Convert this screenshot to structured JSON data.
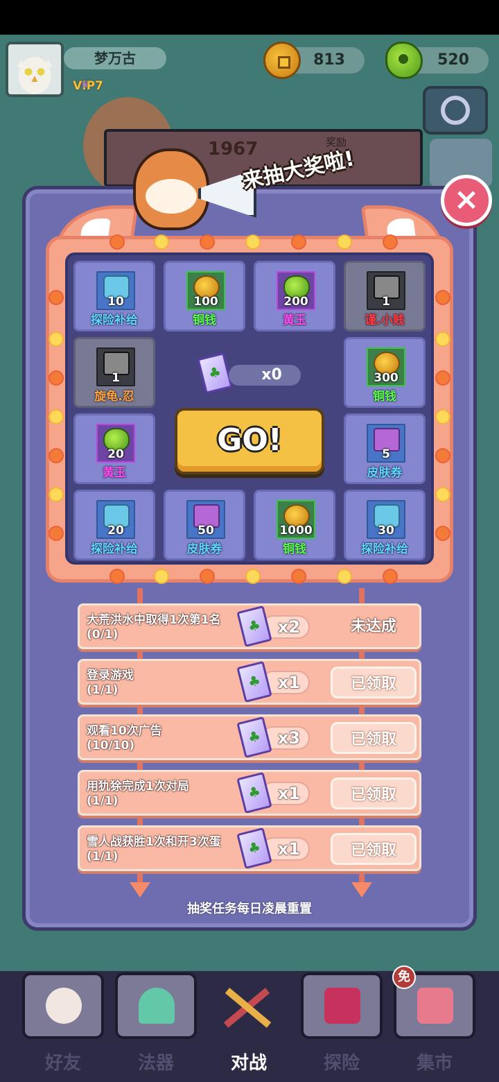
{
  "player": {
    "name": "梦万古",
    "vip": "VIP7"
  },
  "currency": {
    "copper": "813",
    "jade": "520"
  },
  "rank": {
    "score": "1967",
    "reward_label": "奖励"
  },
  "banner": {
    "text": "来抽大奖啦!"
  },
  "close_label": "×",
  "draw": {
    "ticket_count": "x0",
    "go_label": "GO!",
    "cells": [
      {
        "amount": "10",
        "label": "探险补给",
        "type": "supply",
        "frame": "blue",
        "label_color": "#5fd8ff"
      },
      {
        "amount": "100",
        "label": "铜钱",
        "type": "gold",
        "frame": "green",
        "label_color": "#5aff4a"
      },
      {
        "amount": "200",
        "label": "黄玉",
        "type": "jade",
        "frame": "purple",
        "label_color": "#ff4ef0"
      },
      {
        "amount": "1",
        "label": "谨.小贱",
        "type": "weapon",
        "frame": "gray",
        "label_color": "#ff3b3b"
      },
      {
        "amount": "1",
        "label": "旋龟.忍",
        "type": "weapon",
        "frame": "gray",
        "label_color": "#ffa33a"
      },
      {
        "amount": "300",
        "label": "铜钱",
        "type": "gold",
        "frame": "green",
        "label_color": "#5aff4a"
      },
      {
        "amount": "20",
        "label": "黄玉",
        "type": "jade",
        "frame": "purple",
        "label_color": "#ff4ef0"
      },
      {
        "amount": "5",
        "label": "皮肤券",
        "type": "skin",
        "frame": "blue",
        "label_color": "#5fd8ff"
      },
      {
        "amount": "20",
        "label": "探险补给",
        "type": "supply",
        "frame": "blue",
        "label_color": "#5fd8ff"
      },
      {
        "amount": "50",
        "label": "皮肤券",
        "type": "skin",
        "frame": "blue",
        "label_color": "#5fd8ff"
      },
      {
        "amount": "1000",
        "label": "铜钱",
        "type": "gold",
        "frame": "green",
        "label_color": "#5aff4a"
      },
      {
        "amount": "30",
        "label": "探险补给",
        "type": "supply",
        "frame": "blue",
        "label_color": "#5fd8ff"
      }
    ]
  },
  "tasks": [
    {
      "title": "大荒洪水中取得1次第1名",
      "progress": "(0/1)",
      "reward": "x2",
      "status": "未达成",
      "claimed": false
    },
    {
      "title": "登录游戏",
      "progress": "(1/1)",
      "reward": "x1",
      "status": "已领取",
      "claimed": true
    },
    {
      "title": "观看10次广告",
      "progress": "(10/10)",
      "reward": "x3",
      "status": "已领取",
      "claimed": true
    },
    {
      "title": "用犰狳完成1次对局",
      "progress": "(1/1)",
      "reward": "x1",
      "status": "已领取",
      "claimed": true
    },
    {
      "title": "雪人战获胜1次和开3次蛋",
      "progress": "(1/1)",
      "reward": "x1",
      "status": "已领取",
      "claimed": true
    }
  ],
  "reset_note": "抽奖任务每日凌晨重置",
  "nav": {
    "items": [
      "好友",
      "法器",
      "对战",
      "探险",
      "集市"
    ],
    "active": "对战",
    "free_badge": "免"
  }
}
